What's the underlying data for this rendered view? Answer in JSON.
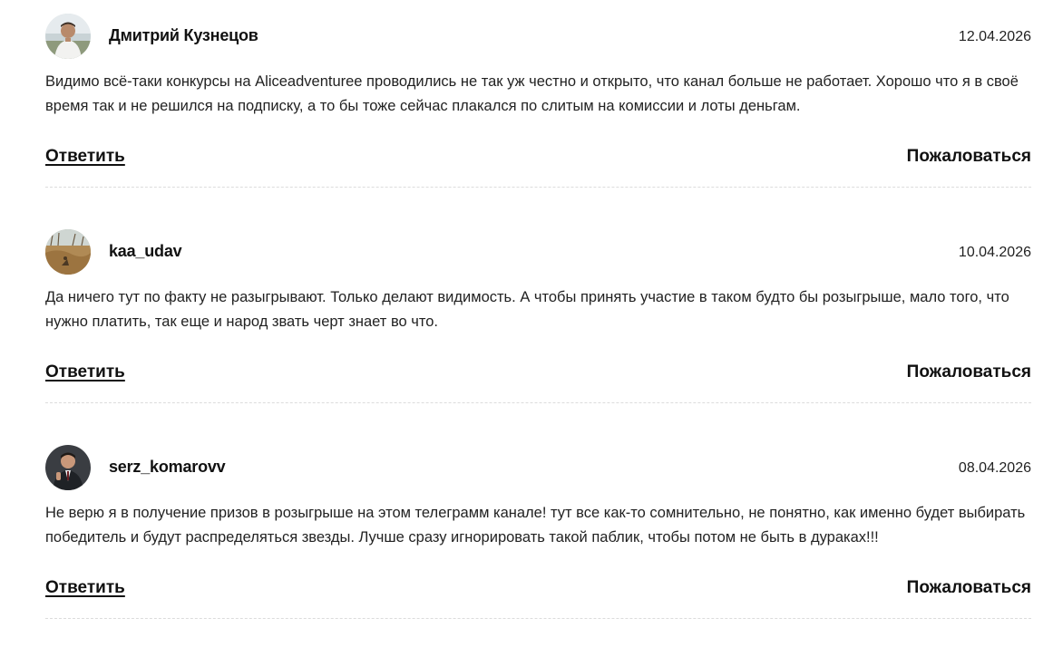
{
  "comments": [
    {
      "avatar_icon": "user-photo-man-outdoors",
      "author": "Дмитрий Кузнецов",
      "date": "12.04.2026",
      "text": "Видимо всё-таки конкурсы на Aliceadventuree проводились не так уж честно и открыто, что канал больше не работает. Хорошо что я в своё время так и не решился на подписку, а то бы тоже сейчас плакался по слитым на комиссии и лоты деньгам.",
      "reply_label": "Ответить",
      "report_label": "Пожаловаться"
    },
    {
      "avatar_icon": "user-photo-field-landscape",
      "author": "kaa_udav",
      "date": "10.04.2026",
      "text": "Да ничего тут по факту не разыгрывают. Только делают видимость. А чтобы принять участие в таком будто бы розыгрыше, мало того, что нужно платить, так еще и народ звать черт знает во что.",
      "reply_label": "Ответить",
      "report_label": "Пожаловаться"
    },
    {
      "avatar_icon": "user-photo-man-in-suit",
      "author": "serz_komarovv",
      "date": "08.04.2026",
      "text": "Не верю я в получение призов в розыгрыше на этом телеграмм канале! тут все как-то сомнительно, не понятно, как именно будет выбирать победитель и будут распределяться звезды. Лучше сразу игнорировать такой паблик, чтобы потом не быть в дураках!!!",
      "reply_label": "Ответить",
      "report_label": "Пожаловаться"
    }
  ]
}
